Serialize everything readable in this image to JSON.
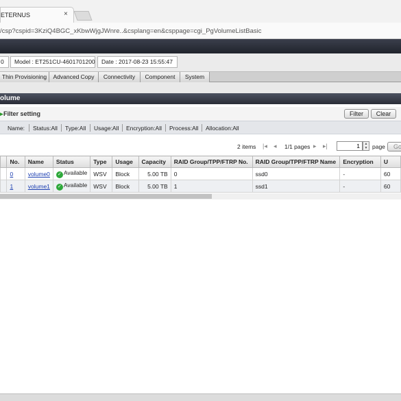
{
  "browser": {
    "tab_title": "ETERNUS",
    "tab_close": "×",
    "url": "/csp?cspid=3KziQ4BGC_xKbwWjgJWnre..&csplang=en&csppage=cgi_PgVolumeListBasic"
  },
  "info": {
    "status_fragment": "0",
    "model": "Model : ET251CU-4601701200",
    "date": "Date : 2017-08-23 15:55:47"
  },
  "menu": {
    "items": [
      "Thin Provisioning",
      "Advanced Copy",
      "Connectivity",
      "Component",
      "System"
    ]
  },
  "section": {
    "title": "olume"
  },
  "filter": {
    "title": "Filter setting",
    "filter_button": "Filter",
    "clear_button": "Clear",
    "summary": [
      "Name:",
      "Status:All",
      "Type:All",
      "Usage:All",
      "Encryption:All",
      "Process:All",
      "Allocation:All"
    ]
  },
  "paging": {
    "items": "2 items",
    "pages": "1/1 pages",
    "page_value": "1",
    "page_label": "page",
    "go_button": "Go"
  },
  "table": {
    "columns": [
      "No.",
      "Name",
      "Status",
      "Type",
      "Usage",
      "Capacity",
      "RAID Group/TPP/FTRP No.",
      "RAID Group/TPP/FTRP Name",
      "Encryption",
      "U"
    ],
    "rows": [
      {
        "no": "0",
        "name": "volume0",
        "status": "Available",
        "type": "WSV",
        "usage": "Block",
        "capacity": "5.00 TB",
        "rg_no": "0",
        "rg_name": "ssd0",
        "encryption": "-",
        "u": "60"
      },
      {
        "no": "1",
        "name": "volume1",
        "status": "Available",
        "type": "WSV",
        "usage": "Block",
        "capacity": "5.00 TB",
        "rg_no": "1",
        "rg_name": "ssd1",
        "encryption": "-",
        "u": "60"
      }
    ]
  },
  "colors": {
    "header_dark": "#2a2d37",
    "available_green": "#2ea83a",
    "link_blue": "#1a3db0"
  }
}
